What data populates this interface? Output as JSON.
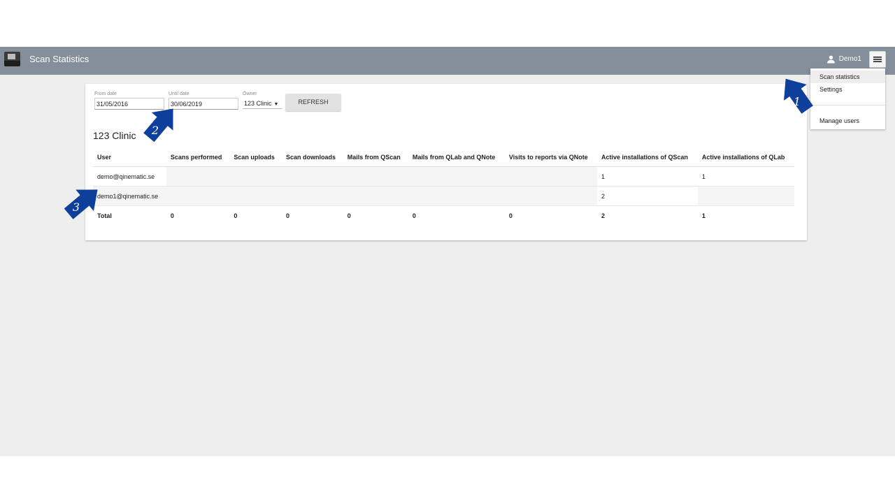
{
  "app": {
    "title": "Scan Statistics",
    "user_name": "Demo1"
  },
  "filters": {
    "from_label": "From date",
    "from_value": "31/05/2016",
    "until_label": "Until date",
    "until_value": "30/06/2019",
    "owner_label": "Owner",
    "owner_value": "123 Clinic",
    "refresh_label": "REFRESH"
  },
  "clinic_name": "123 Clinic",
  "table": {
    "headers": [
      "User",
      "Scans performed",
      "Scan uploads",
      "Scan downloads",
      "Mails from QScan",
      "Mails from QLab and QNote",
      "Visits to reports via QNote",
      "Active installations of QScan",
      "Active installations of QLab"
    ],
    "rows": [
      [
        "demo@qinematic.se",
        "",
        "",
        "",
        "",
        "",
        "",
        "1",
        "1"
      ],
      [
        "demo1@qinematic.se",
        "",
        "",
        "",
        "",
        "",
        "",
        "2",
        ""
      ]
    ],
    "total": [
      "Total",
      "0",
      "0",
      "0",
      "0",
      "0",
      "0",
      "2",
      "1"
    ]
  },
  "menu": {
    "items": [
      {
        "label": "Scan statistics",
        "active": true
      },
      {
        "label": "Settings",
        "active": false
      },
      {
        "label": "Manage users",
        "active": false
      }
    ]
  },
  "callouts": [
    "1",
    "2",
    "3"
  ],
  "colors": {
    "topbar": "#848f9b",
    "background": "#eeeeee",
    "callout": "#0d3f9b"
  }
}
